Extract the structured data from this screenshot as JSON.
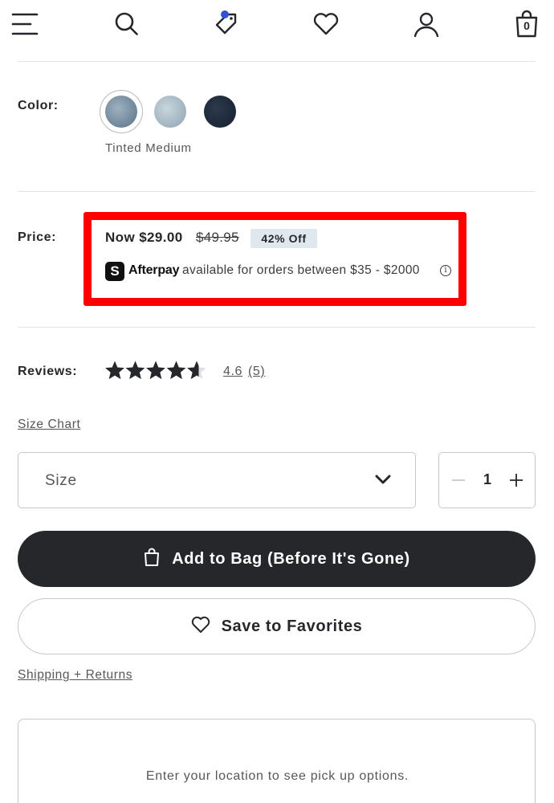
{
  "header": {
    "icons": [
      "menu-icon",
      "search-icon",
      "deals-tag-icon",
      "heart-icon",
      "account-icon",
      "bag-icon"
    ],
    "bag_count": "0",
    "accent": "#3451d6"
  },
  "color": {
    "label": "Color:",
    "selected_name": "Tinted Medium",
    "swatches": [
      "#6e8598",
      "#a9bcc8",
      "#1e2a3a"
    ]
  },
  "price": {
    "label": "Price:",
    "now": "Now $29.00",
    "was": "$49.95",
    "discount": "42% Off",
    "afterpay_logo": "S",
    "afterpay_brand": "Afterpay",
    "afterpay_text": "available for orders between $35 - $2000",
    "info_glyph": "i",
    "highlight_color": "#ff0000"
  },
  "reviews": {
    "label": "Reviews:",
    "rating": "4.6",
    "rating_value": 4.6,
    "max_stars": 5,
    "count": "(5)"
  },
  "size_chart_link": "Size Chart",
  "size": {
    "placeholder": "Size"
  },
  "quantity": {
    "value": "1"
  },
  "buttons": {
    "add_to_bag": "Add to Bag (Before It's Gone)",
    "save_favorites": "Save to Favorites"
  },
  "shipping_link": "Shipping + Returns",
  "pickup": {
    "text": "Enter your location to see pick up options."
  }
}
